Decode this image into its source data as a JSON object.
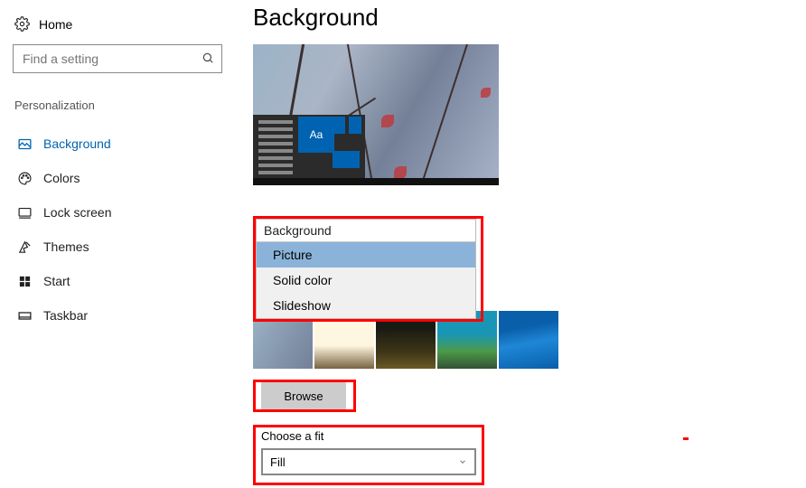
{
  "sidebar": {
    "home": "Home",
    "search_placeholder": "Find a setting",
    "category": "Personalization",
    "items": [
      {
        "label": "Background"
      },
      {
        "label": "Colors"
      },
      {
        "label": "Lock screen"
      },
      {
        "label": "Themes"
      },
      {
        "label": "Start"
      },
      {
        "label": "Taskbar"
      }
    ]
  },
  "main": {
    "title": "Background",
    "preview_sample_text": "Aa",
    "dropdown": {
      "label": "Background",
      "options": [
        "Picture",
        "Solid color",
        "Slideshow"
      ],
      "selected": "Picture"
    },
    "browse_label": "Browse",
    "fit": {
      "label": "Choose a fit",
      "value": "Fill"
    }
  }
}
